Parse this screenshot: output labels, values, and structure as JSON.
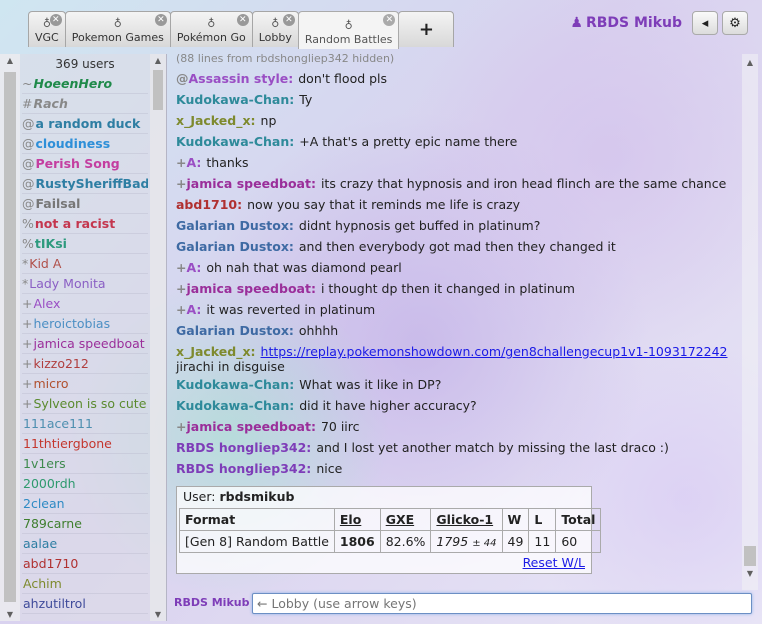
{
  "tabs": [
    {
      "label": "VGC",
      "icon": "chat-icon"
    },
    {
      "label": "Pokemon Games",
      "icon": "chat-icon"
    },
    {
      "label": "Pokémon Go",
      "icon": "chat-icon"
    },
    {
      "label": "Lobby",
      "icon": "chat-icon"
    },
    {
      "label": "Random Battles",
      "icon": "chat-icon",
      "active": true
    }
  ],
  "header": {
    "add_tab_label": "+",
    "username": "RBDS Mikub"
  },
  "userlist": {
    "count": "369 users",
    "users": [
      {
        "rank": "~",
        "name": "HoeenHero",
        "color": "#1f8a4a",
        "bold": true,
        "italic": true
      },
      {
        "rank": "#",
        "name": "Rach",
        "color": "#888888",
        "bold": true,
        "italic": true
      },
      {
        "rank": "@",
        "name": "a random duck",
        "color": "#2e7ea3",
        "bold": true
      },
      {
        "rank": "@",
        "name": "cloudiness",
        "color": "#2e8fd8",
        "bold": true
      },
      {
        "rank": "@",
        "name": "Perish Song",
        "color": "#c43ea0",
        "bold": true
      },
      {
        "rank": "@",
        "name": "RustySheriffBadge",
        "color": "#2e7ea3",
        "bold": true
      },
      {
        "rank": "@",
        "name": "Failsal",
        "color": "#777777",
        "bold": true
      },
      {
        "rank": "%",
        "name": "not a racist",
        "color": "#c4364e",
        "bold": true
      },
      {
        "rank": "%",
        "name": "tIKsi",
        "color": "#2e9a7e",
        "bold": true
      },
      {
        "rank": "*",
        "name": "Kid A",
        "color": "#b0504a"
      },
      {
        "rank": "*",
        "name": "Lady Monita",
        "color": "#8a5fc4"
      },
      {
        "rank": "+",
        "name": "Alex",
        "color": "#9a4ec4"
      },
      {
        "rank": "+",
        "name": "heroictobias",
        "color": "#4c8fc4"
      },
      {
        "rank": "+",
        "name": "jamica speedboat",
        "color": "#9a2e9a"
      },
      {
        "rank": "+",
        "name": "kizzo212",
        "color": "#b03e3e"
      },
      {
        "rank": "+",
        "name": "micro",
        "color": "#b0502e"
      },
      {
        "rank": "+",
        "name": "Sylveon is so cute",
        "color": "#5a8a2e"
      },
      {
        "rank": "",
        "name": "111ace111",
        "color": "#4e8fb0"
      },
      {
        "rank": "",
        "name": "11thtiergbone",
        "color": "#c4362e"
      },
      {
        "rank": "",
        "name": "1v1ers",
        "color": "#3e8a4e"
      },
      {
        "rank": "",
        "name": "2000rdh",
        "color": "#2e9a6e"
      },
      {
        "rank": "",
        "name": "2clean",
        "color": "#2e8ac4"
      },
      {
        "rank": "",
        "name": "789carne",
        "color": "#3e7e2e"
      },
      {
        "rank": "",
        "name": "aalae",
        "color": "#2e7ea3"
      },
      {
        "rank": "",
        "name": "abd1710",
        "color": "#b03030"
      },
      {
        "rank": "",
        "name": "Achim",
        "color": "#7e8a2e"
      },
      {
        "rank": "",
        "name": "ahzutiltrol",
        "color": "#3e4a9a"
      }
    ]
  },
  "chat": {
    "hidden_note": "(88 lines from rbdshongliep342 hidden)",
    "messages": [
      {
        "rank": "@",
        "author": "Assassin style:",
        "color": "#9a4ec4",
        "text": "don't flood pls"
      },
      {
        "rank": "",
        "author": "Kudokawa-Chan:",
        "color": "#2e8a9a",
        "text": "Ty"
      },
      {
        "rank": "",
        "author": "x_Jacked_x:",
        "color": "#7e8a2e",
        "text": "np"
      },
      {
        "rank": "",
        "author": "Kudokawa-Chan:",
        "color": "#2e8a9a",
        "text": "+A that's a pretty epic name there"
      },
      {
        "rank": "+",
        "author": "A:",
        "color": "#9a4ec4",
        "text": "thanks"
      },
      {
        "rank": "+",
        "author": "jamica speedboat:",
        "color": "#9a2e9a",
        "text": "its crazy that hypnosis and iron head flinch are the same chance"
      },
      {
        "rank": "",
        "author": "abd1710:",
        "color": "#b03030",
        "text": "now you say that it reminds me life is crazy"
      },
      {
        "rank": "",
        "author": "Galarian Dustox:",
        "color": "#3e6aa3",
        "text": "didnt hypnosis get buffed in platinum?"
      },
      {
        "rank": "",
        "author": "Galarian Dustox:",
        "color": "#3e6aa3",
        "text": "and then everybody got mad then they changed it"
      },
      {
        "rank": "+",
        "author": "A:",
        "color": "#9a4ec4",
        "text": "oh nah that was diamond pearl"
      },
      {
        "rank": "+",
        "author": "jamica speedboat:",
        "color": "#9a2e9a",
        "text": "i thought dp then it changed in platinum"
      },
      {
        "rank": "+",
        "author": "A:",
        "color": "#9a4ec4",
        "text": "it was reverted in platinum"
      },
      {
        "rank": "",
        "author": "Galarian Dustox:",
        "color": "#3e6aa3",
        "text": "ohhhh"
      },
      {
        "rank": "",
        "author": "x_Jacked_x:",
        "color": "#7e8a2e",
        "text": "",
        "link": "https://replay.pokemonshowdown.com/gen8challengecup1v1-1093172242",
        "after": "jirachi in disguise"
      },
      {
        "rank": "",
        "author": "Kudokawa-Chan:",
        "color": "#2e8a9a",
        "text": "What was it like in DP?"
      },
      {
        "rank": "",
        "author": "Kudokawa-Chan:",
        "color": "#2e8a9a",
        "text": "did it have higher accuracy?"
      },
      {
        "rank": "+",
        "author": "jamica speedboat:",
        "color": "#9a2e9a",
        "text": "70 iirc"
      },
      {
        "rank": "",
        "author": "RBDS hongliep342:",
        "color": "#7e3db8",
        "text": "and I lost yet another match by missing the last draco :)"
      },
      {
        "rank": "",
        "author": "RBDS hongliep342:",
        "color": "#7e3db8",
        "text": "nice"
      }
    ]
  },
  "usercard": {
    "user_label": "User:",
    "username": "rbdsmikub",
    "headers": [
      "Format",
      "Elo",
      "GXE",
      "Glicko-1",
      "W",
      "L",
      "Total"
    ],
    "row": {
      "format": "[Gen 8] Random Battle",
      "elo": "1806",
      "gxe": "82.6%",
      "glicko": "1795",
      "glicko_dev": "± 44",
      "w": "49",
      "l": "11",
      "total": "60"
    },
    "reset_label": "Reset W/L"
  },
  "input": {
    "label": "RBDS Mikub",
    "placeholder": "← Lobby (use arrow keys)"
  }
}
